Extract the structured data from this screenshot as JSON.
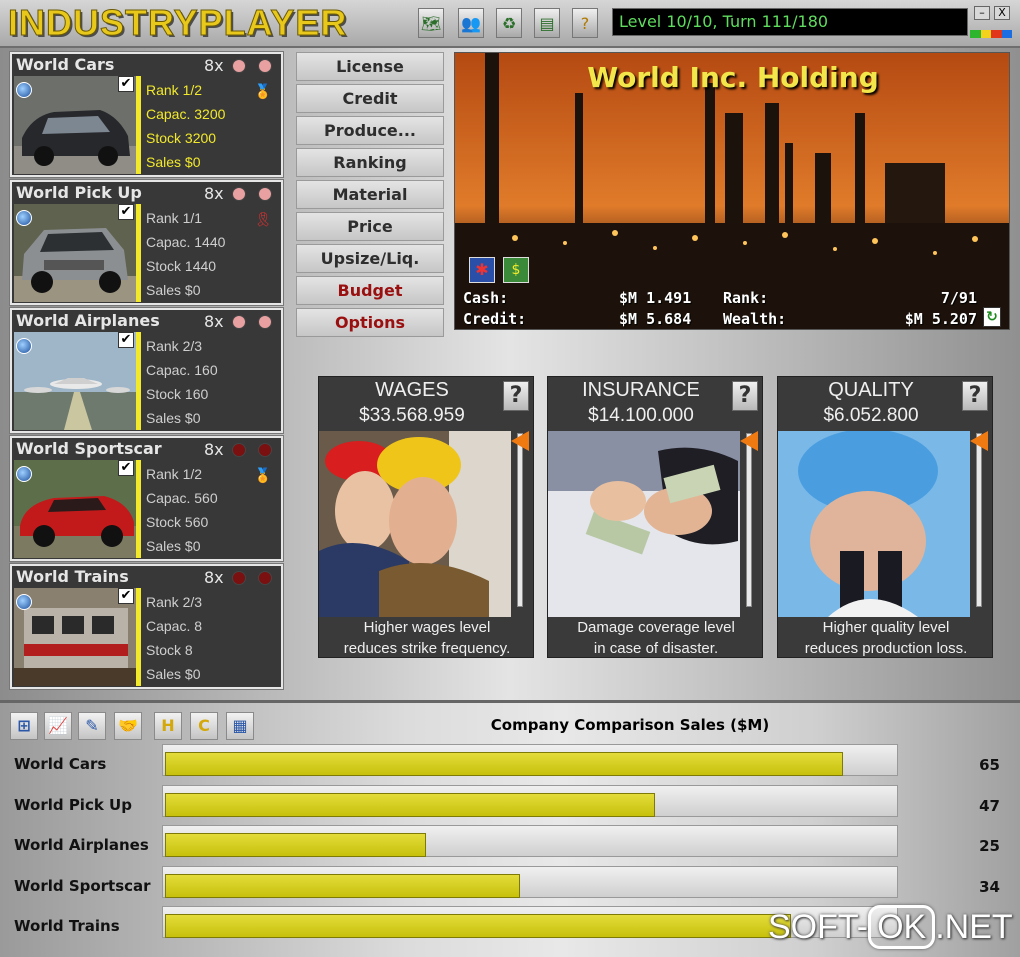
{
  "app": {
    "logo": "INDUSTRYPLAYER",
    "level_status": "Level 10/10, Turn 111/180"
  },
  "window_controls": {
    "minimize": "–",
    "close": "X"
  },
  "toolbar_icons": [
    "map-icon",
    "people-icon",
    "recycle-icon",
    "stats-icon",
    "help-icon"
  ],
  "status_lamps": [
    "#2db52d",
    "#f2d21b",
    "#e2361b",
    "#1b6ee2"
  ],
  "products": [
    {
      "name": "World Cars",
      "multiplier": "8x",
      "rank": "Rank 1/2",
      "capacity": "Capac. 3200",
      "stock": "Stock 3200",
      "sales": "Sales $0",
      "checked": "✔"
    },
    {
      "name": "World Pick Up",
      "multiplier": "8x",
      "rank": "Rank 1/1",
      "capacity": "Capac. 1440",
      "stock": "Stock 1440",
      "sales": "Sales $0",
      "checked": "✔"
    },
    {
      "name": "World Airplanes",
      "multiplier": "8x",
      "rank": "Rank 2/3",
      "capacity": "Capac. 160",
      "stock": "Stock 160",
      "sales": "Sales $0",
      "checked": "✔"
    },
    {
      "name": "World Sportscar",
      "multiplier": "8x",
      "rank": "Rank 1/2",
      "capacity": "Capac. 560",
      "stock": "Stock 560",
      "sales": "Sales $0",
      "checked": "✔"
    },
    {
      "name": "World Trains",
      "multiplier": "8x",
      "rank": "Rank 2/3",
      "capacity": "Capac. 8",
      "stock": "Stock 8",
      "sales": "Sales $0",
      "checked": "✔"
    }
  ],
  "menu": [
    "License",
    "Credit",
    "Produce...",
    "Ranking",
    "Material",
    "Price",
    "Upsize/Liq.",
    "Budget",
    "Options"
  ],
  "company": {
    "name": "World Inc. Holding",
    "cash_label": "Cash:",
    "cash_value": "$M 1.491",
    "credit_label": "Credit:",
    "credit_value": "$M 5.684",
    "rank_label": "Rank:",
    "rank_value": "7/91",
    "wealth_label": "Wealth:",
    "wealth_value": "$M 5.207"
  },
  "budget": [
    {
      "title": "WAGES",
      "amount": "$33.568.959",
      "desc1": "Higher wages level",
      "desc2": "reduces strike frequency.",
      "level": 1.0,
      "help": "?"
    },
    {
      "title": "INSURANCE",
      "amount": "$14.100.000",
      "desc1": "Damage coverage level",
      "desc2": "in case of disaster.",
      "level": 1.0,
      "help": "?"
    },
    {
      "title": "QUALITY",
      "amount": "$6.052.800",
      "desc1": "Higher quality level",
      "desc2": "reduces production loss.",
      "level": 1.0,
      "help": "?"
    }
  ],
  "bottom_toolbar": [
    {
      "icon": "tree-icon",
      "label": ""
    },
    {
      "icon": "line-chart-icon",
      "label": ""
    },
    {
      "icon": "pen-icon",
      "label": ""
    },
    {
      "icon": "handshake-icon",
      "label": ""
    },
    {
      "icon": "h-icon",
      "label": "H"
    },
    {
      "icon": "c-icon",
      "label": "C"
    },
    {
      "icon": "calculator-icon",
      "label": ""
    }
  ],
  "chart_data": {
    "type": "bar",
    "title": "Company Comparison Sales ($M)",
    "categories": [
      "World Cars",
      "World Pick Up",
      "World Airplanes",
      "World Sportscar",
      "World Trains"
    ],
    "values": [
      65,
      47,
      25,
      34,
      60
    ],
    "value_labels": [
      "65",
      "47",
      "25",
      "34",
      ""
    ],
    "xlim": [
      0,
      70
    ],
    "bar_color": "#d6cf1e"
  },
  "watermark": {
    "left": "SOFT-",
    "mid": "OK",
    "right": ".NET"
  }
}
